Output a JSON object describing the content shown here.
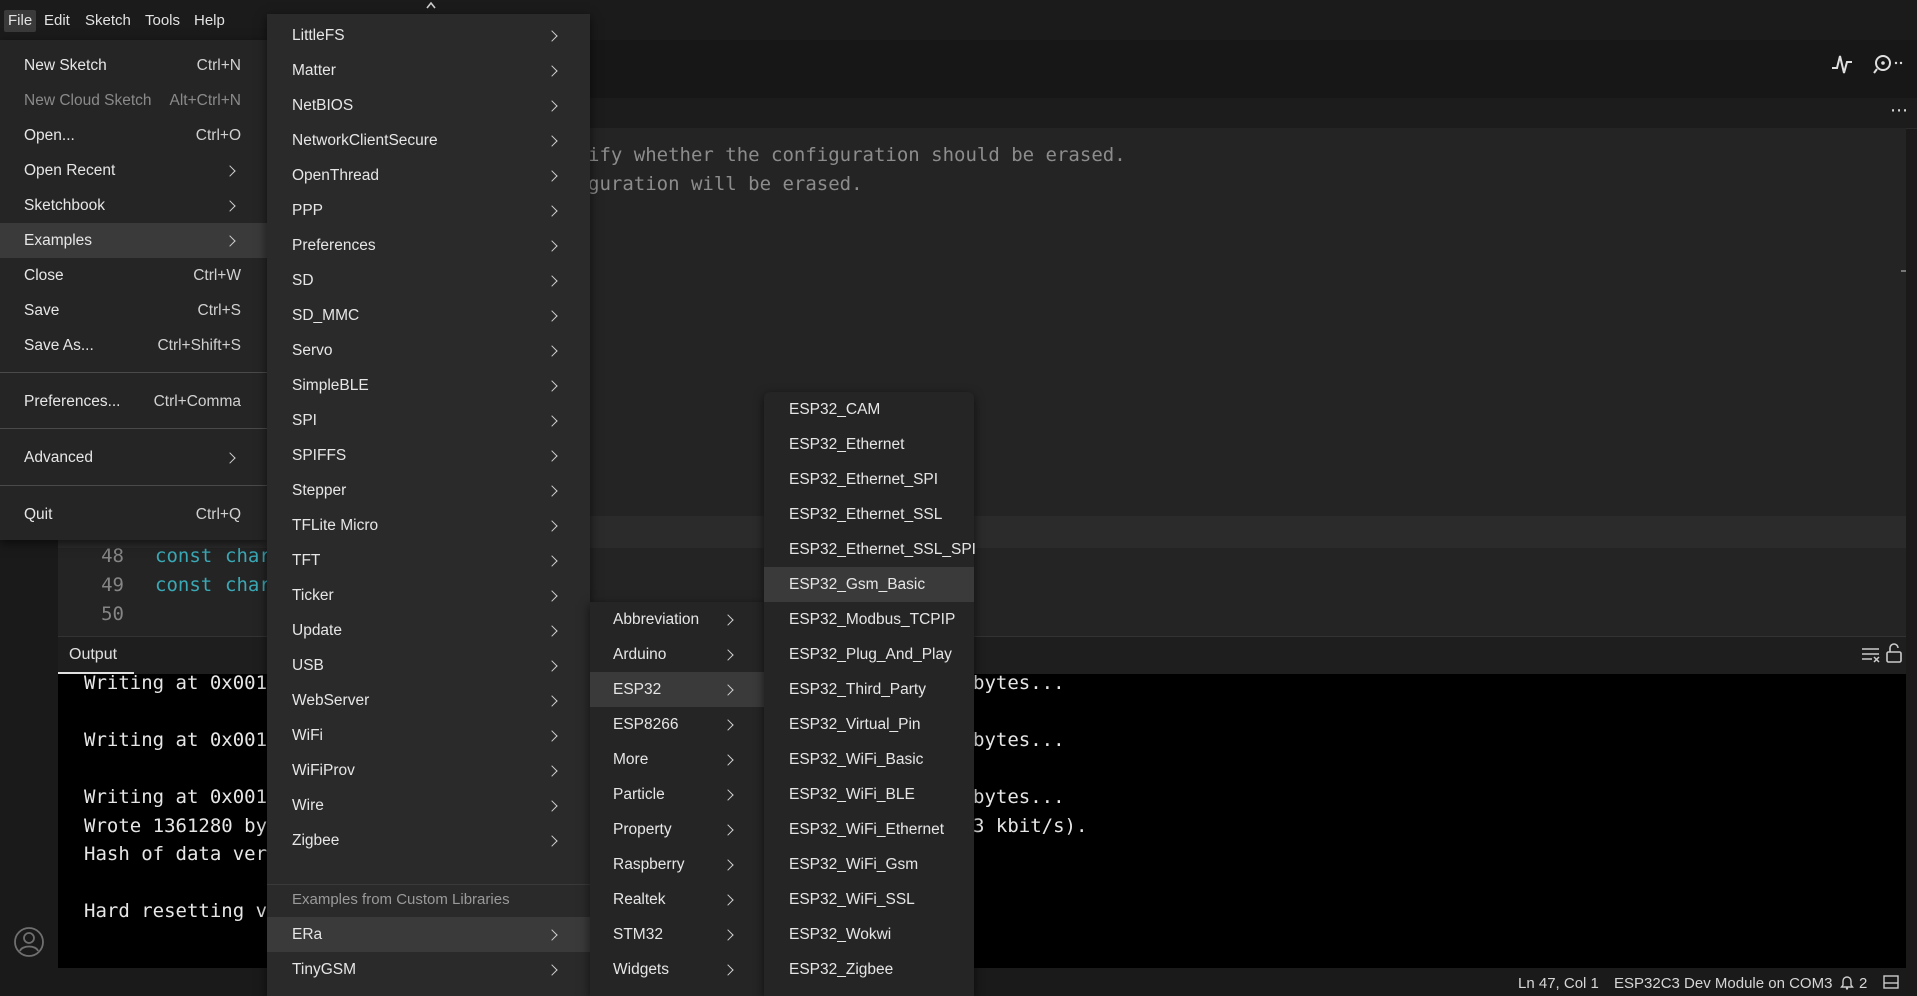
{
  "menubar": {
    "items": [
      "File",
      "Edit",
      "Sketch",
      "Tools",
      "Help"
    ]
  },
  "editor": {
    "comment_line1": "ify whether the configuration should be erased.",
    "comment_line2": "guration will be erased.",
    "lines": [
      {
        "num": "48",
        "kw": "const",
        "text": "char"
      },
      {
        "num": "49",
        "kw": "const",
        "text": "char"
      },
      {
        "num": "50",
        "kw": "",
        "text": ""
      }
    ]
  },
  "output": {
    "title": "Output",
    "lines_left": [
      "Writing at 0x001",
      "Writing at 0x001",
      "Writing at 0x001",
      "Wrote 1361280 by",
      "Hash of data ver",
      "Hard resetting v"
    ],
    "lines_right": [
      "bytes...",
      "bytes...",
      "bytes...",
      "3 kbit/s)."
    ]
  },
  "statusbar": {
    "position": "Ln 47, Col 1",
    "board": "ESP32C3 Dev Module on COM3",
    "notifications": "2"
  },
  "file_menu": {
    "items": [
      {
        "label": "New Sketch",
        "shortcut": "Ctrl+N"
      },
      {
        "label": "New Cloud Sketch",
        "shortcut": "Alt+Ctrl+N",
        "disabled": true
      },
      {
        "label": "Open...",
        "shortcut": "Ctrl+O"
      },
      {
        "label": "Open Recent",
        "submenu": true
      },
      {
        "label": "Sketchbook",
        "submenu": true
      },
      {
        "label": "Examples",
        "submenu": true,
        "highlighted": true
      },
      {
        "label": "Close",
        "shortcut": "Ctrl+W"
      },
      {
        "label": "Save",
        "shortcut": "Ctrl+S"
      },
      {
        "label": "Save As...",
        "shortcut": "Ctrl+Shift+S"
      },
      {
        "label": "Preferences...",
        "shortcut": "Ctrl+Comma"
      },
      {
        "label": "Advanced",
        "submenu": true
      },
      {
        "label": "Quit",
        "shortcut": "Ctrl+Q"
      }
    ]
  },
  "examples_menu": {
    "items": [
      "LittleFS",
      "Matter",
      "NetBIOS",
      "NetworkClientSecure",
      "OpenThread",
      "PPP",
      "Preferences",
      "SD",
      "SD_MMC",
      "Servo",
      "SimpleBLE",
      "SPI",
      "SPIFFS",
      "Stepper",
      "TFLite Micro",
      "TFT",
      "Ticker",
      "Update",
      "USB",
      "WebServer",
      "WiFi",
      "WiFiProv",
      "Wire",
      "Zigbee"
    ],
    "custom_header": "Examples from Custom Libraries",
    "custom_items": [
      "ERa",
      "TinyGSM"
    ]
  },
  "era_menu": {
    "items": [
      "Abbreviation",
      "Arduino",
      "ESP32",
      "ESP8266",
      "More",
      "Particle",
      "Property",
      "Raspberry",
      "Realtek",
      "STM32",
      "Widgets"
    ],
    "highlighted": "ESP32"
  },
  "esp32_menu": {
    "items": [
      "ESP32_CAM",
      "ESP32_Ethernet",
      "ESP32_Ethernet_SPI",
      "ESP32_Ethernet_SSL",
      "ESP32_Ethernet_SSL_SPI",
      "ESP32_Gsm_Basic",
      "ESP32_Modbus_TCPIP",
      "ESP32_Plug_And_Play",
      "ESP32_Third_Party",
      "ESP32_Virtual_Pin",
      "ESP32_WiFi_Basic",
      "ESP32_WiFi_BLE",
      "ESP32_WiFi_Ethernet",
      "ESP32_WiFi_Gsm",
      "ESP32_WiFi_SSL",
      "ESP32_Wokwi",
      "ESP32_Zigbee"
    ],
    "highlighted": "ESP32_Gsm_Basic"
  }
}
